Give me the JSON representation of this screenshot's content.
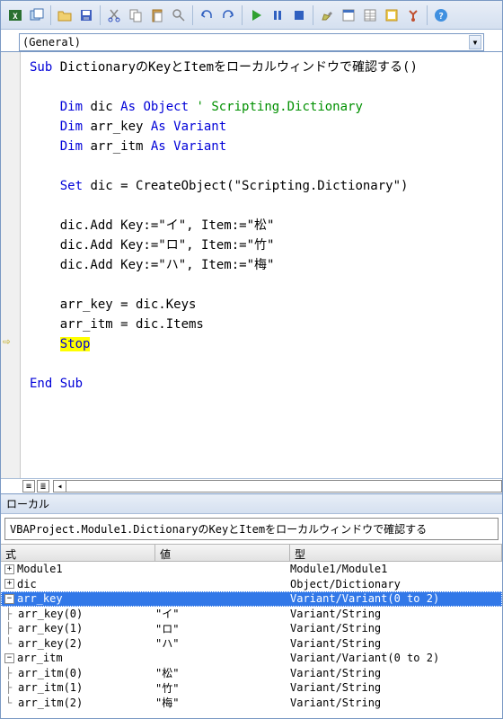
{
  "toolbar": {
    "icons": [
      "excel",
      "view",
      "open",
      "save",
      "cut",
      "copy",
      "paste",
      "find",
      "undo",
      "redo",
      "run",
      "break",
      "reset",
      "design",
      "explorer",
      "props",
      "browser",
      "toolbox",
      "help"
    ]
  },
  "dropdowns": {
    "left": "(General)"
  },
  "code_arrow_line": 16,
  "code_lines": [
    {
      "t": [
        {
          "c": "kw",
          "s": "Sub"
        },
        {
          "s": " DictionaryのKeyとItemをローカルウィンドウで確認する()"
        }
      ]
    },
    {
      "t": []
    },
    {
      "t": [
        {
          "s": "    "
        },
        {
          "c": "kw",
          "s": "Dim"
        },
        {
          "s": " dic "
        },
        {
          "c": "kw",
          "s": "As Object"
        },
        {
          "s": " "
        },
        {
          "c": "cm",
          "s": "' Scripting.Dictionary"
        }
      ]
    },
    {
      "t": [
        {
          "s": "    "
        },
        {
          "c": "kw",
          "s": "Dim"
        },
        {
          "s": " arr_key "
        },
        {
          "c": "kw",
          "s": "As Variant"
        }
      ]
    },
    {
      "t": [
        {
          "s": "    "
        },
        {
          "c": "kw",
          "s": "Dim"
        },
        {
          "s": " arr_itm "
        },
        {
          "c": "kw",
          "s": "As Variant"
        }
      ]
    },
    {
      "t": []
    },
    {
      "t": [
        {
          "s": "    "
        },
        {
          "c": "kw",
          "s": "Set"
        },
        {
          "s": " dic = CreateObject(\"Scripting.Dictionary\")"
        }
      ]
    },
    {
      "t": []
    },
    {
      "t": [
        {
          "s": "    dic.Add Key:=\"イ\", Item:=\"松\""
        }
      ]
    },
    {
      "t": [
        {
          "s": "    dic.Add Key:=\"ロ\", Item:=\"竹\""
        }
      ]
    },
    {
      "t": [
        {
          "s": "    dic.Add Key:=\"ハ\", Item:=\"梅\""
        }
      ]
    },
    {
      "t": []
    },
    {
      "t": [
        {
          "s": "    arr_key = dic.Keys"
        }
      ]
    },
    {
      "t": [
        {
          "s": "    arr_itm = dic.Items"
        }
      ]
    },
    {
      "t": [
        {
          "s": "    "
        },
        {
          "c": "hl kw",
          "s": "Stop"
        }
      ]
    },
    {
      "t": []
    },
    {
      "t": [
        {
          "c": "kw",
          "s": "End Sub"
        }
      ]
    }
  ],
  "locals": {
    "title": "ローカル",
    "context": "VBAProject.Module1.DictionaryのKeyとItemをローカルウィンドウで確認する",
    "headers": {
      "expr": "式",
      "value": "値",
      "type": "型"
    },
    "rows": [
      {
        "icon": "plus",
        "indent": 0,
        "expr": "Module1",
        "val": "",
        "type": "Module1/Module1"
      },
      {
        "icon": "plus",
        "indent": 0,
        "expr": "dic",
        "val": "",
        "type": "Object/Dictionary"
      },
      {
        "icon": "minus",
        "indent": 0,
        "expr": "arr_key",
        "val": "",
        "type": "Variant/Variant(0 to 2)",
        "sel": true
      },
      {
        "icon": "branch",
        "indent": 1,
        "expr": "arr_key(0)",
        "val": "\"イ\"",
        "type": "Variant/String"
      },
      {
        "icon": "branch",
        "indent": 1,
        "expr": "arr_key(1)",
        "val": "\"ロ\"",
        "type": "Variant/String"
      },
      {
        "icon": "end",
        "indent": 1,
        "expr": "arr_key(2)",
        "val": "\"ハ\"",
        "type": "Variant/String"
      },
      {
        "icon": "minus",
        "indent": 0,
        "expr": "arr_itm",
        "val": "",
        "type": "Variant/Variant(0 to 2)"
      },
      {
        "icon": "branch",
        "indent": 1,
        "expr": "arr_itm(0)",
        "val": "\"松\"",
        "type": "Variant/String"
      },
      {
        "icon": "branch",
        "indent": 1,
        "expr": "arr_itm(1)",
        "val": "\"竹\"",
        "type": "Variant/String"
      },
      {
        "icon": "end",
        "indent": 1,
        "expr": "arr_itm(2)",
        "val": "\"梅\"",
        "type": "Variant/String"
      }
    ]
  }
}
